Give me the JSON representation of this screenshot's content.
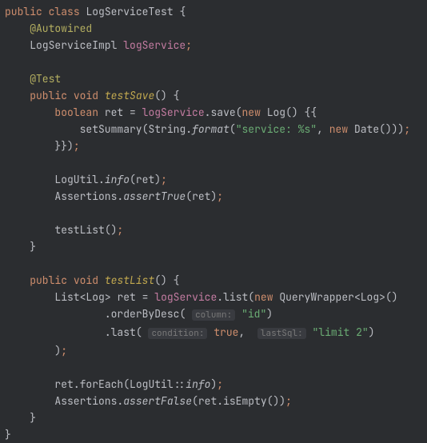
{
  "code": {
    "l1": {
      "kw1": "public",
      "kw2": "class",
      "cls": "LogServiceTest",
      "br": "{"
    },
    "l2": {
      "ann": "@Autowired"
    },
    "l3": {
      "cls": "LogServiceImpl",
      "field": "logService",
      "semi": ";"
    },
    "l5": {
      "ann": "@Test"
    },
    "l6": {
      "kw1": "public",
      "kw2": "void",
      "fn": "testSave",
      "p": "()",
      "br": "{"
    },
    "l7": {
      "kw": "boolean",
      "var": "ret",
      "eq": " = ",
      "field": "logService",
      "dot": ".",
      "call": "save",
      "po": "(",
      "new": "new",
      "cls": "Log",
      "p2": "()",
      "br": "{{"
    },
    "l8": {
      "call": "setSummary",
      "po": "(",
      "cls": "String",
      "dot": ".",
      "static": "format",
      "po2": "(",
      "str": "\"service: %s\"",
      "comma": ",",
      "new": "new",
      "cls2": "Date",
      "p2": "()))",
      "semi": ";"
    },
    "l9": {
      "br": "}})",
      "semi": ";"
    },
    "l11": {
      "cls": "LogUtil",
      "dot": ".",
      "static": "info",
      "po": "(",
      "var": "ret",
      "pc": ")",
      "semi": ";"
    },
    "l12": {
      "cls": "Assertions",
      "dot": ".",
      "static": "assertTrue",
      "po": "(",
      "var": "ret",
      "pc": ")",
      "semi": ";"
    },
    "l14": {
      "call": "testList",
      "p": "()",
      "semi": ";"
    },
    "l15": {
      "br": "}"
    },
    "l17": {
      "kw1": "public",
      "kw2": "void",
      "fn": "testList",
      "p": "()",
      "br": "{"
    },
    "l18": {
      "cls": "List",
      "lt": "<",
      "cls2": "Log",
      "gt": ">",
      "var": "ret",
      "eq": " = ",
      "field": "logService",
      "dot": ".",
      "call": "list",
      "po": "(",
      "new": "new",
      "cls3": "QueryWrapper",
      "lt2": "<",
      "cls4": "Log",
      "gt2": ">",
      "p2": "()"
    },
    "l19": {
      "dot": ".",
      "call": "orderByDesc",
      "po": "(",
      "hint": "column:",
      "str": "\"id\"",
      "pc": ")"
    },
    "l20": {
      "dot": ".",
      "call": "last",
      "po": "(",
      "hint1": "condition:",
      "bool": "true",
      "comma": ",",
      "hint2": "lastSql:",
      "str": "\"limit 2\"",
      "pc": ")"
    },
    "l21": {
      "pc": ")",
      "semi": ";"
    },
    "l23": {
      "var": "ret",
      "dot": ".",
      "call": "forEach",
      "po": "(",
      "cls": "LogUtil",
      "cc": "::",
      "static": "info",
      "pc": ")",
      "semi": ";"
    },
    "l24": {
      "cls": "Assertions",
      "dot": ".",
      "static": "assertFalse",
      "po": "(",
      "var": "ret",
      "dot2": ".",
      "call": "isEmpty",
      "p2": "()",
      "pc": ")",
      "semi": ";"
    },
    "l25": {
      "br": "}"
    },
    "l26": {
      "br": "}"
    }
  }
}
